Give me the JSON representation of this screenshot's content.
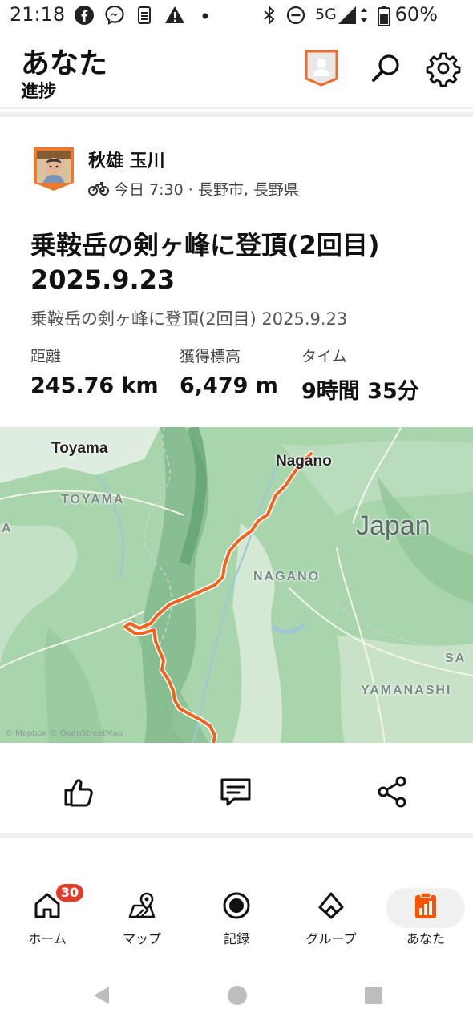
{
  "status_bar": {
    "time": "21:18",
    "network": "5G",
    "battery": "60%"
  },
  "header": {
    "title": "あなた",
    "subtitle": "進捗",
    "icons": [
      "profile-badge-icon",
      "search-icon",
      "gear-icon"
    ]
  },
  "activity": {
    "athlete_name": "秋雄 玉川",
    "meta": "今日 7:30 · 長野市, 長野県",
    "title": "乗鞍岳の剣ヶ峰に登頂(2回目) 2025.9.23",
    "description": "乗鞍岳の剣ヶ峰に登頂(2回目) 2025.9.23",
    "stats": [
      {
        "label": "距離",
        "value": "245.76 km"
      },
      {
        "label": "獲得標高",
        "value": "6,479 m"
      },
      {
        "label": "タイム",
        "value": "9時間 35分"
      }
    ]
  },
  "map": {
    "labels": {
      "toyama_city": "Toyama",
      "nagano_city": "Nagano",
      "toyama_pref": "TOYAMA",
      "nagano_pref": "NAGANO",
      "country": "Japan",
      "yamanashi": "YAMANASHI",
      "sa": "SA",
      "edge_a": "A"
    },
    "attribution": "© Mapbox © OpenStreetMap",
    "route_color": "#f0641e"
  },
  "actions": [
    "thumbs-up-icon",
    "comment-icon",
    "share-icon"
  ],
  "nav": {
    "items": [
      {
        "label": "ホーム",
        "icon": "home-icon"
      },
      {
        "label": "マップ",
        "icon": "map-icon"
      },
      {
        "label": "記録",
        "icon": "record-icon"
      },
      {
        "label": "グループ",
        "icon": "groups-icon"
      },
      {
        "label": "あなた",
        "icon": "you-icon"
      }
    ],
    "home_badge": "30",
    "active": "あなた",
    "accent": "#fc5200"
  }
}
